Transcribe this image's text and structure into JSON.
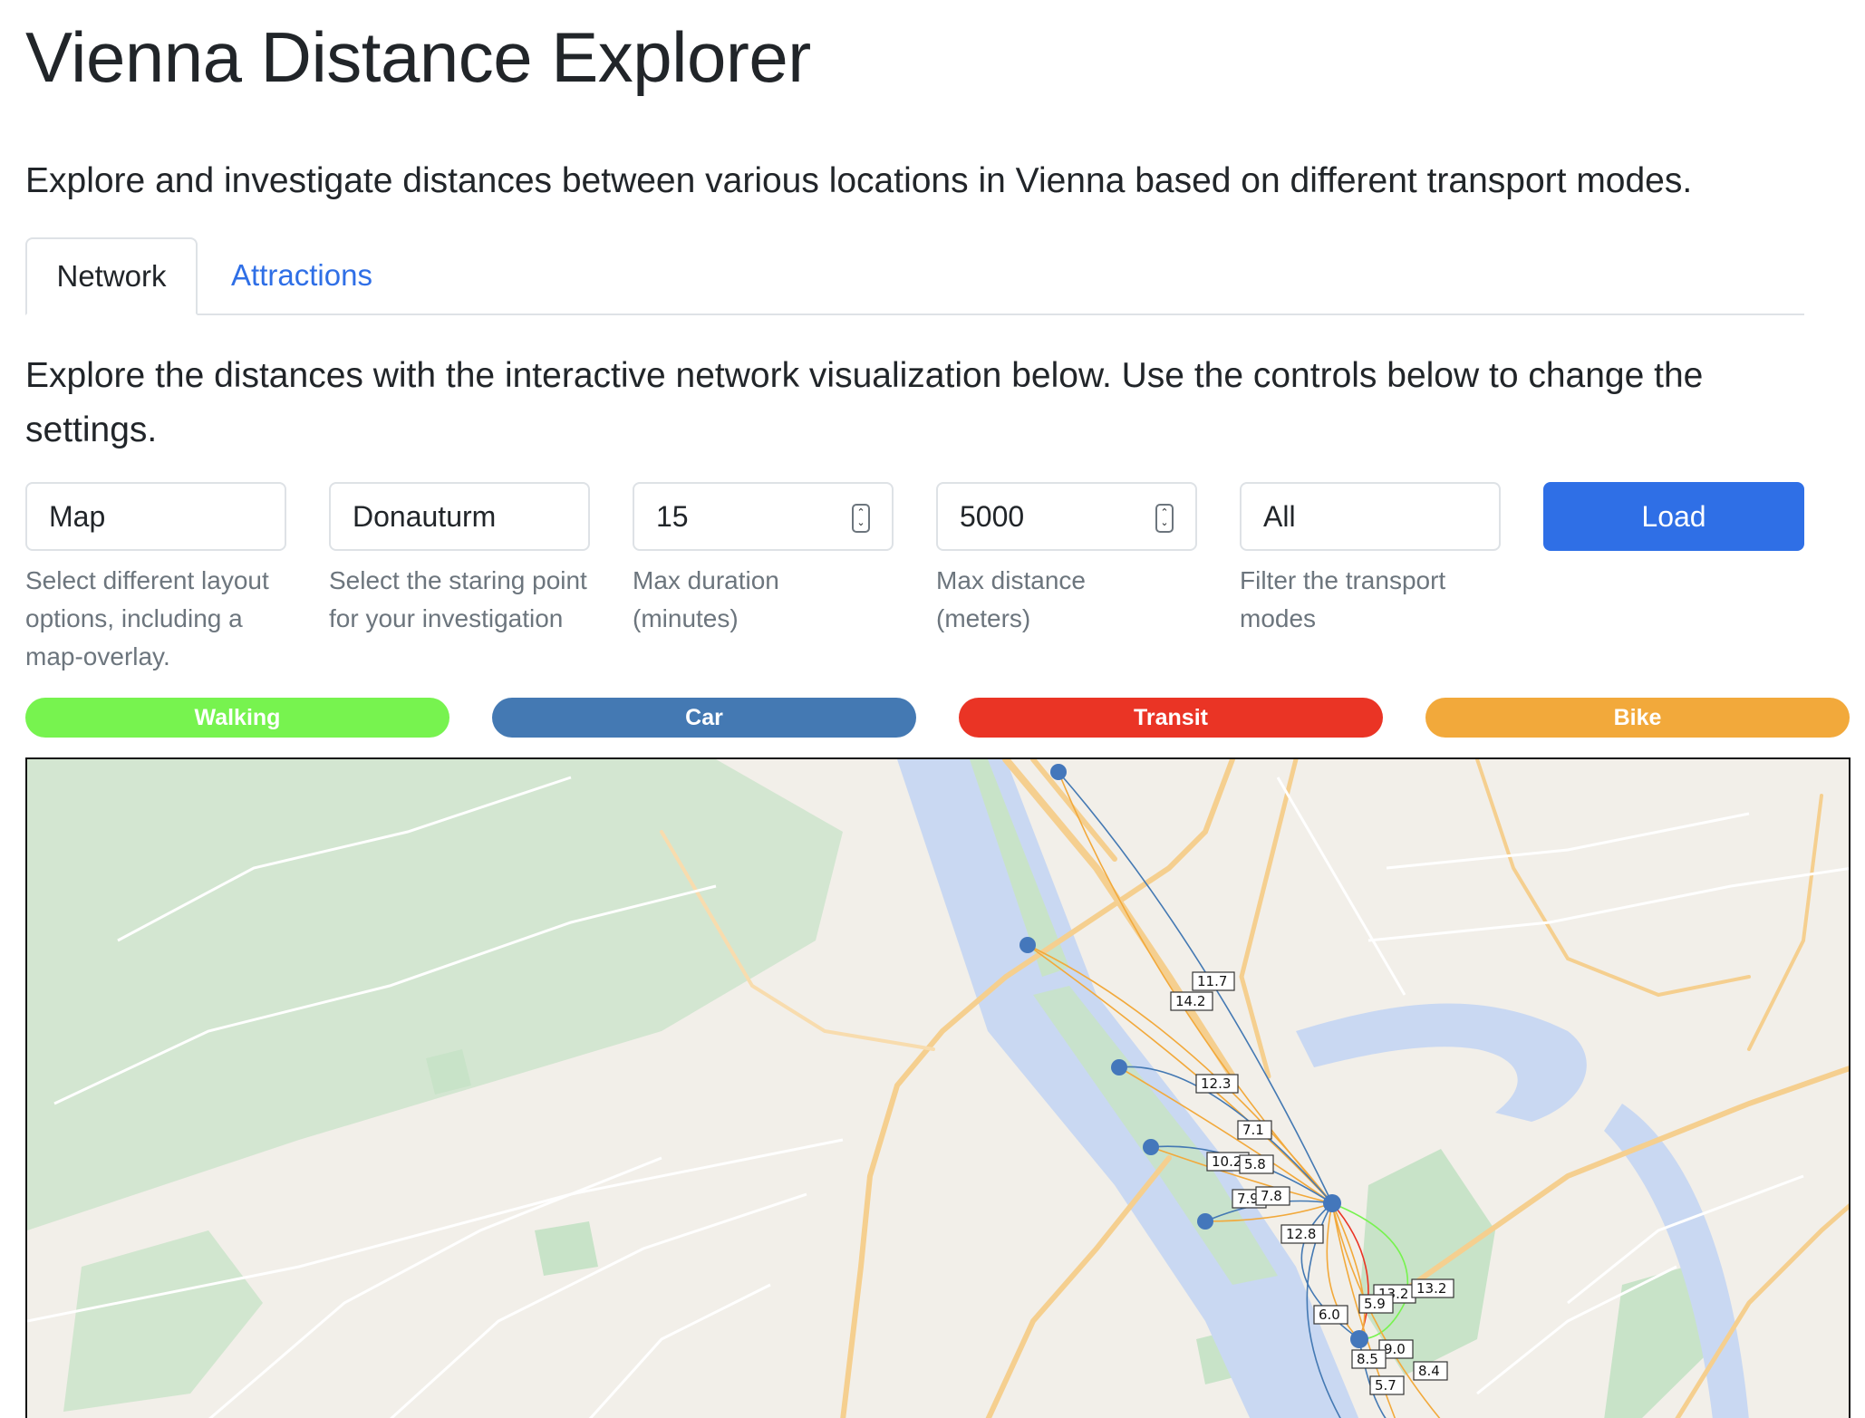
{
  "header": {
    "title": "Vienna Distance Explorer",
    "lead": "Explore and investigate distances between various locations in Vienna based on different transport modes."
  },
  "tabs": [
    {
      "label": "Network",
      "active": true
    },
    {
      "label": "Attractions",
      "active": false
    }
  ],
  "intro": "Explore the distances with the interactive network visualization below. Use the controls below to change the settings.",
  "controls": {
    "layout": {
      "value": "Map",
      "help": "Select different layout options, including a map-overlay."
    },
    "start": {
      "value": "Donauturm",
      "help": "Select the staring point for your investigation"
    },
    "duration": {
      "value": "15",
      "help": "Max duration (minutes)"
    },
    "distance": {
      "value": "5000",
      "help": "Max distance (meters)"
    },
    "modes": {
      "value": "All",
      "help": "Filter the transport modes"
    },
    "load_label": "Load"
  },
  "legend": [
    {
      "label": "Walking",
      "color": "#77f34f"
    },
    {
      "label": "Car",
      "color": "#4479b3"
    },
    {
      "label": "Transit",
      "color": "#ea3425"
    },
    {
      "label": "Bike",
      "color": "#f2a93b"
    }
  ],
  "map": {
    "edge_labels": [
      "11.7",
      "14.2",
      "12.3",
      "7.1",
      "10.2",
      "5.8",
      "7.9",
      "7.8",
      "12.8",
      "13.2",
      "13.2",
      "5.9",
      "6.0",
      "9.0",
      "8.5",
      "8.4",
      "5.7"
    ],
    "colors": {
      "water": "#c9d8f2",
      "park": "#c8e3c8",
      "road_major": "#f5cf8f",
      "land": "#f2efe9",
      "node": "#4477bb"
    }
  }
}
